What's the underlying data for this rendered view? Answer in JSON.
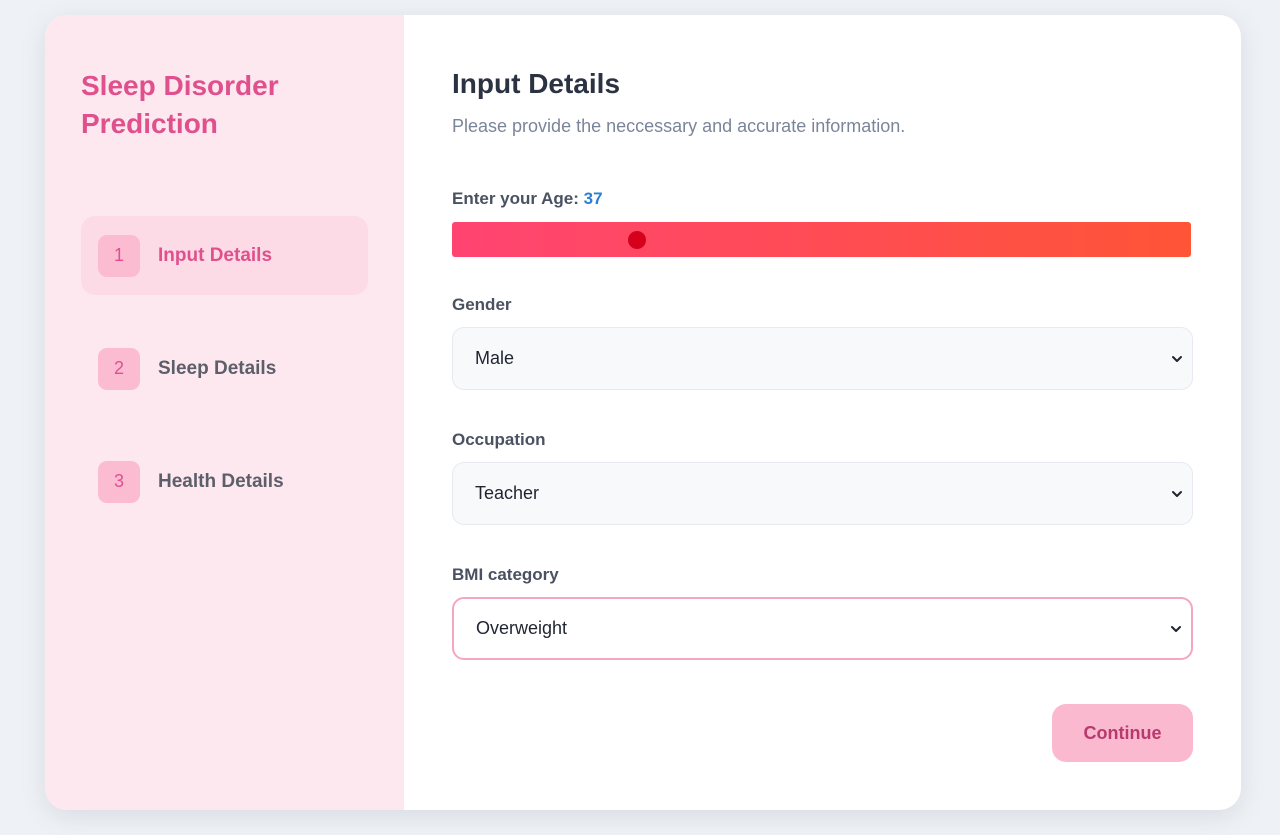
{
  "sidebar": {
    "brand": "Sleep Disorder Prediction",
    "steps": [
      {
        "number": "1",
        "label": "Input Details",
        "active": true
      },
      {
        "number": "2",
        "label": "Sleep Details",
        "active": false
      },
      {
        "number": "3",
        "label": "Health Details",
        "active": false
      }
    ]
  },
  "main": {
    "title": "Input Details",
    "subtitle": "Please provide the neccessary and accurate information.",
    "age": {
      "label": "Enter your Age:",
      "value": "37",
      "slider_fraction": 0.25
    },
    "gender": {
      "label": "Gender",
      "value": "Male"
    },
    "occupation": {
      "label": "Occupation",
      "value": "Teacher"
    },
    "bmi": {
      "label": "BMI category",
      "value": "Overweight"
    },
    "continue_label": "Continue"
  },
  "colors": {
    "brand": "#e0508c",
    "slider_start": "#ff4472",
    "slider_end": "#ff5436",
    "thumb": "#d6001c",
    "continue_bg": "#fbb9d0"
  },
  "icons": {
    "select_chevron": "chevron-down-icon"
  }
}
